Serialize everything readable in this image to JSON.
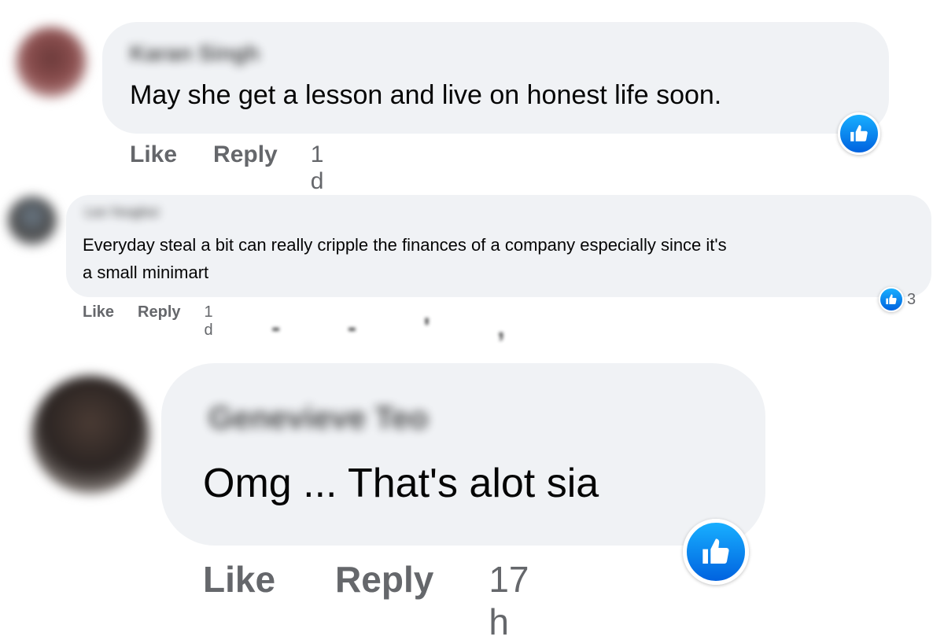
{
  "comments": [
    {
      "author": "Karan Singh",
      "text": "May she get a lesson and live on honest life soon.",
      "like_label": "Like",
      "reply_label": "Reply",
      "time": "1 d",
      "reaction_icon": "like-icon",
      "reaction_count": ""
    },
    {
      "author": "Lee Yeoghui",
      "text": "Everyday steal a bit can really cripple the finances of a company especially since it's",
      "text_line2": "a small minimart",
      "like_label": "Like",
      "reply_label": "Reply",
      "time": "1 d",
      "reaction_icon": "like-icon",
      "reaction_count": "3"
    },
    {
      "author": "Genevieve Teo",
      "text": "Omg ... That's alot sia",
      "like_label": "Like",
      "reply_label": "Reply",
      "time": "17 h",
      "reaction_icon": "like-icon",
      "reaction_count": ""
    }
  ],
  "colors": {
    "bubble": "#f0f2f5",
    "text": "#050505",
    "secondary": "#65676b",
    "like_blue_top": "#18afff",
    "like_blue_bottom": "#0062df"
  }
}
